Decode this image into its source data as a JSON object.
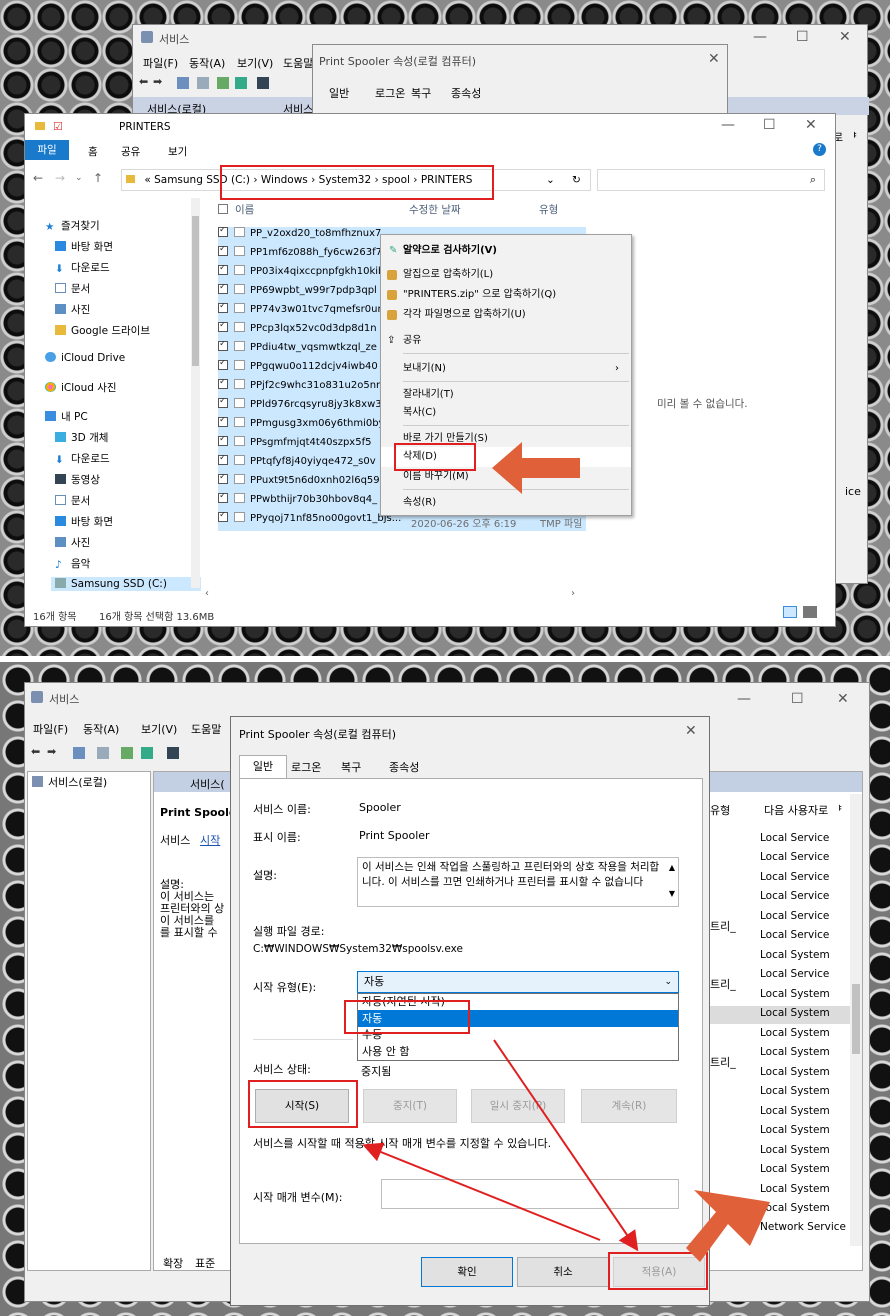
{
  "top": {
    "services_title": "서비스",
    "services_menu": [
      "파일(F)",
      "동작(A)",
      "보기(V)",
      "도움말"
    ],
    "services_tab_local": "서비스(로컬)",
    "services_tab_local2": "서비스",
    "props_title_small": "Print Spooler 속성(로컬 컴퓨터)",
    "props_tabs_small": [
      "일반",
      "로그온",
      "복구",
      "종속성"
    ],
    "explorer": {
      "title": "PRINTERS",
      "ribbon_tabs": [
        "파일",
        "홈",
        "공유",
        "보기"
      ],
      "address": [
        "« Samsung SSD (C:)",
        "Windows",
        "System32",
        "spool",
        "PRINTERS"
      ],
      "col_name": "이름",
      "col_modified": "수정한 날짜",
      "col_type": "유형",
      "nav": {
        "quick_access": "즐겨찾기",
        "desktop": "바탕 화면",
        "downloads": "다운로드",
        "documents": "문서",
        "pictures": "사진",
        "gdrive": "Google 드라이브",
        "icloud_drive": "iCloud Drive",
        "icloud_photos": "iCloud 사진",
        "this_pc": "내 PC",
        "objects3d": "3D 개체",
        "downloads2": "다운로드",
        "videos": "동영상",
        "documents2": "문서",
        "desktop2": "바탕 화면",
        "pictures2": "사진",
        "music": "음악",
        "ssd": "Samsung SSD (C:)"
      },
      "files": [
        "PP_v2oxd20_to8mfhznux7",
        "PP1mf6z088h_fy6cw263f7",
        "PP03ix4qixccpnpfgkh10kib",
        "PP69wpbt_w99r7pdp3qpl",
        "PP74v3w01tvc7qmefsr0ur",
        "PPcp3lqx52vc0d3dp8d1n",
        "PPdiu4tw_vqsmwtkzql_ze",
        "PPgqwu0o112dcjv4iwb40",
        "PPjf2c9whc31o831u2o5nr",
        "PPld976rcqsyru8jy3k8xw3",
        "PPmgusg3xm06y6thmi0by",
        "PPsgmfmjqt4t40szpx5f5",
        "PPtqfyf8j40yiyqe472_s0v",
        "PPuxt9t5n6d0xnh02l6q59",
        "PPwbthijr70b30hbov8q4_",
        "PPyqoj71nf85no00govt1_bjs..."
      ],
      "last_date": "2020-06-26 오후 6:19",
      "last_type": "TMP 파일",
      "preview_text": "미리 볼 수 없습니다.",
      "status_count": "16개 항목",
      "status_selected": "16개 항목 선택함 13.6MB"
    },
    "context_menu": [
      "알약으로 검사하기(V)",
      "알집으로 압축하기(L)",
      "\"PRINTERS.zip\" 으로 압축하기(Q)",
      "각각 파일명으로 압축하기(U)",
      "공유",
      "보내기(N)",
      "잘라내기(T)",
      "복사(C)",
      "바로 가기 만들기(S)",
      "삭제(D)",
      "이름 바꾸기(M)",
      "속성(R)"
    ],
    "right_partial": [
      "로 ᅣ",
      "ice"
    ]
  },
  "bottom": {
    "services_title": "서비스",
    "services_menu": [
      "파일(F)",
      "동작(A)",
      "보기(V)",
      "도움말"
    ],
    "tree_root": "서비스(로컬)",
    "tab_header": "서비스(",
    "left_title": "Print Spoole",
    "left_link_prefix": "서비스",
    "left_link": "시작",
    "left_desc": [
      "설명:",
      "이 서비스는",
      "프린터와의 상",
      "이 서비스를",
      "를 표시할 수"
    ],
    "bottom_tabs": [
      "확장",
      "표준"
    ],
    "col_type": "유형",
    "col_logon": "다음 사용자로 ᅣ",
    "type_cells": [
      "트리_",
      "트리_",
      "트리_"
    ],
    "logon_list": [
      "Local Service",
      "Local Service",
      "Local Service",
      "Local Service",
      "Local Service",
      "Local Service",
      "Local System",
      "Local Service",
      "Local System",
      "Local System",
      "Local System",
      "Local System",
      "Local System",
      "Local System",
      "Local System",
      "Local System",
      "Local System",
      "Local System",
      "Local System",
      "Local System",
      "Network Service"
    ],
    "dialog": {
      "title": "Print Spooler 속성(로컬 컴퓨터)",
      "tabs": [
        "일반",
        "로그온",
        "복구",
        "종속성"
      ],
      "service_name_label": "서비스 이름:",
      "service_name": "Spooler",
      "display_name_label": "표시 이름:",
      "display_name": "Print Spooler",
      "desc_label": "설명:",
      "desc_text": "이 서비스는 인쇄 작업을 스풀링하고 프린터와의 상호 작용을 처리합니다. 이 서비스를 끄면 인쇄하거나 프린터를 표시할 수 없습니다",
      "path_label": "실행 파일 경로:",
      "path": "C:₩WINDOWS₩System32₩spoolsv.exe",
      "startup_label": "시작 유형(E):",
      "startup_value": "자동",
      "startup_options": [
        "자동(지연된 시작)",
        "자동",
        "수동",
        "사용 안 함"
      ],
      "status_label": "서비스 상태:",
      "status_value": "중지됨",
      "btn_start": "시작(S)",
      "btn_stop": "중지(T)",
      "btn_pause": "일시 중지(P)",
      "btn_resume": "계속(R)",
      "hint": "서비스를 시작할 때 적용할 시작 매개 변수를 지정할 수 있습니다.",
      "param_label": "시작 매개 변수(M):",
      "btn_ok": "확인",
      "btn_cancel": "취소",
      "btn_apply": "적용(A)"
    }
  },
  "colors": {
    "highlight_red": "#e02020",
    "arrow_orange": "#e0603a",
    "selection_blue": "#cce8ff",
    "dropdown_select": "#0078d7"
  }
}
